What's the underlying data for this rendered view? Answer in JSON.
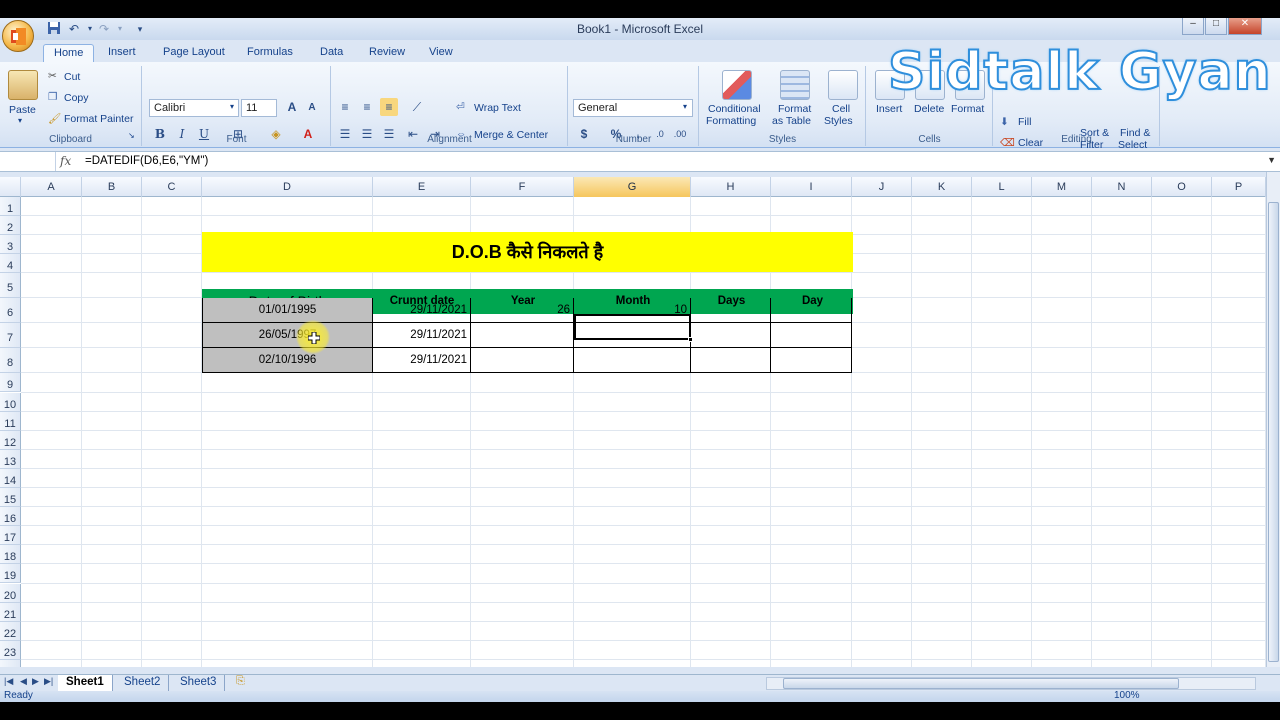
{
  "window": {
    "title": "Book1 - Microsoft Excel",
    "controls": {
      "minimize": "–",
      "restore": "□",
      "close": "✕"
    }
  },
  "qat": {
    "save_icon": "save-icon",
    "undo_icon": "undo-icon",
    "redo_icon": "redo-icon"
  },
  "tabs": [
    {
      "label": "Home"
    },
    {
      "label": "Insert"
    },
    {
      "label": "Page Layout"
    },
    {
      "label": "Formulas"
    },
    {
      "label": "Data"
    },
    {
      "label": "Review"
    },
    {
      "label": "View"
    }
  ],
  "ribbon": {
    "clipboard": {
      "label": "Clipboard",
      "paste": "Paste",
      "cut": "Cut",
      "copy": "Copy",
      "format_painter": "Format Painter"
    },
    "font": {
      "label": "Font",
      "font_name": "Calibri",
      "font_size": "11",
      "bold": "B",
      "italic": "I",
      "underline": "U"
    },
    "alignment": {
      "label": "Alignment",
      "wrap_text": "Wrap Text",
      "merge_center": "Merge & Center"
    },
    "number": {
      "label": "Number",
      "format": "General",
      "currency": "$",
      "percent": "%",
      "comma": ","
    },
    "styles": {
      "label": "Styles",
      "conditional": "Conditional",
      "conditional2": "Formatting",
      "format_table": "Format",
      "format_table2": "as Table",
      "cell_styles": "Cell",
      "cell_styles2": "Styles"
    },
    "cells": {
      "label": "Cells",
      "insert": "Insert",
      "delete": "Delete",
      "format": "Format"
    },
    "editing": {
      "label": "Editing",
      "fill": "Fill",
      "clear": "Clear",
      "sort": "Sort &",
      "sort2": "Filter",
      "find": "Find &",
      "find2": "Select"
    }
  },
  "formula_bar": {
    "fx": "fx",
    "formula": "=DATEDIF(D6,E6,\"YM\")"
  },
  "columns": [
    "A",
    "B",
    "C",
    "D",
    "E",
    "F",
    "G",
    "H",
    "I",
    "J",
    "K",
    "L",
    "M",
    "N",
    "O",
    "P"
  ],
  "rows": [
    "1",
    "2",
    "3",
    "4",
    "5",
    "6",
    "7",
    "8",
    "9",
    "10",
    "11",
    "12",
    "13",
    "14",
    "15",
    "16",
    "17",
    "18",
    "19",
    "20",
    "21",
    "22",
    "23",
    "24"
  ],
  "sheet": {
    "banner": "D.O.B कैसे निकलते है",
    "headers": [
      "Date of Birth",
      "Crunnt date",
      "Year",
      "Month",
      "Days",
      "Day"
    ],
    "table": [
      {
        "dob": "01/01/1995",
        "current": "29/11/2021",
        "year": "26",
        "month": "10",
        "days": "",
        "day": ""
      },
      {
        "dob": "26/05/1997",
        "current": "29/11/2021",
        "year": "",
        "month": "",
        "days": "",
        "day": ""
      },
      {
        "dob": "02/10/1996",
        "current": "29/11/2021",
        "year": "",
        "month": "",
        "days": "",
        "day": ""
      }
    ]
  },
  "sheet_tabs": [
    "Sheet1",
    "Sheet2",
    "Sheet3"
  ],
  "status": {
    "ready": "Ready",
    "zoom": "100%"
  },
  "watermark": "Sidtalk Gyan",
  "colors": {
    "banner": "#ffff00",
    "header_row": "#00a650",
    "dob_fill": "#bfbfbf",
    "selected_col": "#f6c65d"
  }
}
